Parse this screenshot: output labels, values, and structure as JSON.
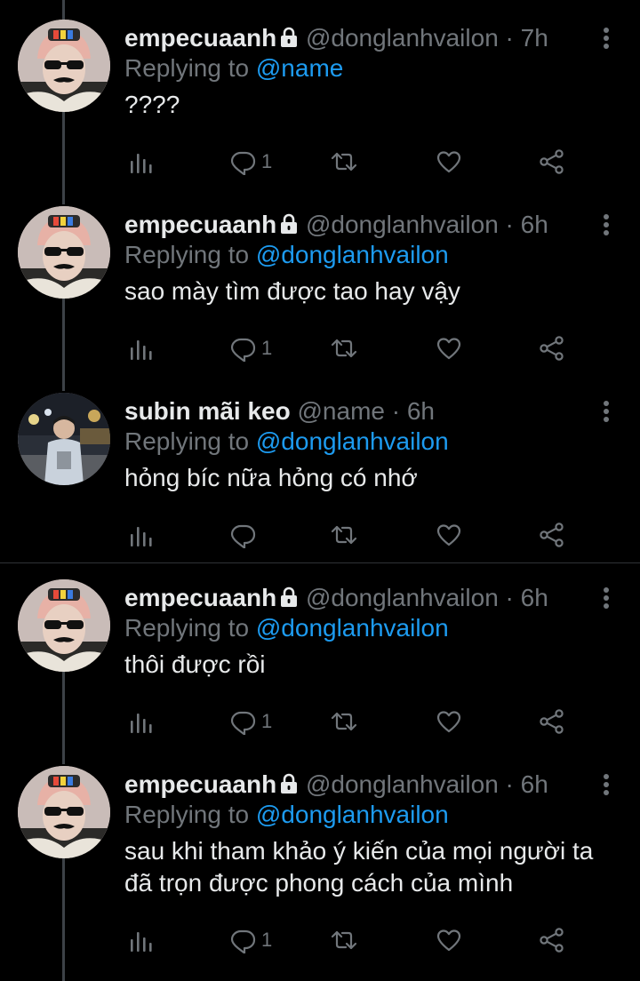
{
  "tweets": [
    {
      "name": "empecuaanh",
      "locked": true,
      "handle": "@donglanhvailon",
      "time": "· 7h",
      "replying_prefix": "Replying to ",
      "replying_to": "@name",
      "text": "????",
      "reply_count": "1",
      "avatar": "user-avatar"
    },
    {
      "name": "empecuaanh",
      "locked": true,
      "handle": "@donglanhvailon",
      "time": "· 6h",
      "replying_prefix": "Replying to ",
      "replying_to": "@donglanhvailon",
      "text": "sao mày tìm được tao hay vậy",
      "reply_count": "1",
      "avatar": "user-avatar"
    },
    {
      "name": "subin mãi keo",
      "locked": false,
      "handle": "@name",
      "time": "· 6h",
      "replying_prefix": "Replying to ",
      "replying_to": "@donglanhvailon",
      "text": "hỏng bíc nữa hỏng có nhớ",
      "reply_count": "",
      "avatar": "other-avatar"
    },
    {
      "name": "empecuaanh",
      "locked": true,
      "handle": "@donglanhvailon",
      "time": "· 6h",
      "replying_prefix": "Replying to ",
      "replying_to": "@donglanhvailon",
      "text": "thôi được rồi",
      "reply_count": "1",
      "avatar": "user-avatar"
    },
    {
      "name": "empecuaanh",
      "locked": true,
      "handle": "@donglanhvailon",
      "time": "· 6h",
      "replying_prefix": "Replying to ",
      "replying_to": "@donglanhvailon",
      "text": "sau khi tham khảo ý kiến của mọi người ta đã trọn được phong cách của mình",
      "reply_count": "1",
      "avatar": "user-avatar"
    }
  ],
  "icons": {
    "analytics": "analytics-icon",
    "reply": "reply-icon",
    "retweet": "retweet-icon",
    "like": "like-icon",
    "share": "share-icon",
    "more": "more-icon",
    "lock": "lock-icon"
  },
  "colors": {
    "background": "#000000",
    "text": "#e7e9ea",
    "secondary": "#71767b",
    "mention": "#1d9bf0",
    "thread_line": "#3d4247"
  }
}
